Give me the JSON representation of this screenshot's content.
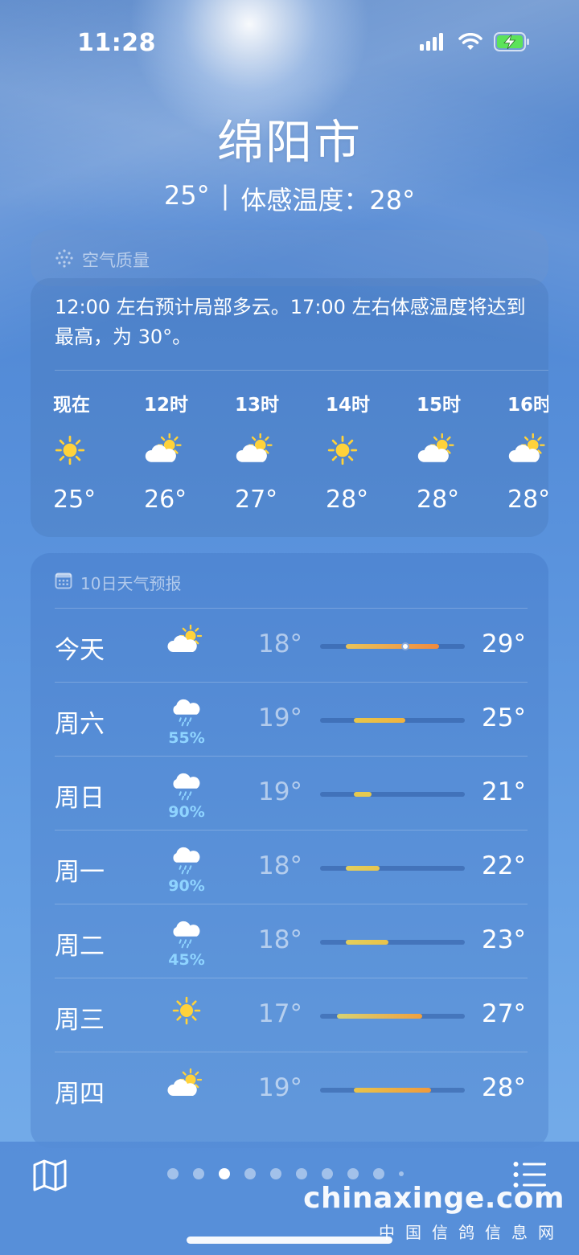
{
  "status_bar": {
    "time": "11:28"
  },
  "header": {
    "city": "绵阳市",
    "current_temp": "25°",
    "separator": "|",
    "feels_like": "体感温度：28°"
  },
  "air_quality": {
    "label": "空气质量"
  },
  "hourly": {
    "summary": "12:00 左右预计局部多云。17:00 左右体感温度将达到最高，为 30°。",
    "hours": [
      {
        "label": "现在",
        "icon": "sun-icon",
        "temp": "25°"
      },
      {
        "label": "12时",
        "icon": "partly-cloudy-icon",
        "temp": "26°"
      },
      {
        "label": "13时",
        "icon": "partly-cloudy-icon",
        "temp": "27°"
      },
      {
        "label": "14时",
        "icon": "sun-icon",
        "temp": "28°"
      },
      {
        "label": "15时",
        "icon": "partly-cloudy-icon",
        "temp": "28°"
      },
      {
        "label": "16时",
        "icon": "partly-cloudy-icon",
        "temp": "28°"
      }
    ]
  },
  "forecast": {
    "title": "10日天气预报",
    "range_min": 15,
    "range_max": 32,
    "days": [
      {
        "day": "今天",
        "icon": "partly-cloudy-icon",
        "pop": "",
        "low": "18°",
        "high": "29°",
        "low_val": 18,
        "high_val": 29,
        "current_val": 25,
        "colors": [
          "#e9c45a",
          "#f08a3e"
        ]
      },
      {
        "day": "周六",
        "icon": "rain-icon",
        "pop": "55%",
        "low": "19°",
        "high": "25°",
        "low_val": 19,
        "high_val": 25,
        "current_val": null,
        "colors": [
          "#e7c64b",
          "#f0b23f"
        ]
      },
      {
        "day": "周日",
        "icon": "rain-icon",
        "pop": "90%",
        "low": "19°",
        "high": "21°",
        "low_val": 19,
        "high_val": 21,
        "current_val": null,
        "colors": [
          "#e6c94e",
          "#e6c94e"
        ]
      },
      {
        "day": "周一",
        "icon": "rain-icon",
        "pop": "90%",
        "low": "18°",
        "high": "22°",
        "low_val": 18,
        "high_val": 22,
        "current_val": null,
        "colors": [
          "#e3cf5c",
          "#e6c54f"
        ]
      },
      {
        "day": "周二",
        "icon": "rain-icon",
        "pop": "45%",
        "low": "18°",
        "high": "23°",
        "low_val": 18,
        "high_val": 23,
        "current_val": null,
        "colors": [
          "#e3cf5c",
          "#e8c24a"
        ]
      },
      {
        "day": "周三",
        "icon": "sun-icon",
        "pop": "",
        "low": "17°",
        "high": "27°",
        "low_val": 17,
        "high_val": 27,
        "current_val": null,
        "colors": [
          "#d8d373",
          "#f0a03d"
        ]
      },
      {
        "day": "周四",
        "icon": "partly-cloudy-icon",
        "pop": "",
        "low": "19°",
        "high": "28°",
        "low_val": 19,
        "high_val": 28,
        "current_val": null,
        "colors": [
          "#e8c44b",
          "#f09a3c"
        ]
      }
    ]
  },
  "bottom_bar": {
    "map_icon": "map-icon",
    "list_icon": "list-icon",
    "page_count": 10,
    "active_page": 3
  },
  "watermark": {
    "main": "chinaxinge.com",
    "sub": "中国信鸽信息网"
  }
}
